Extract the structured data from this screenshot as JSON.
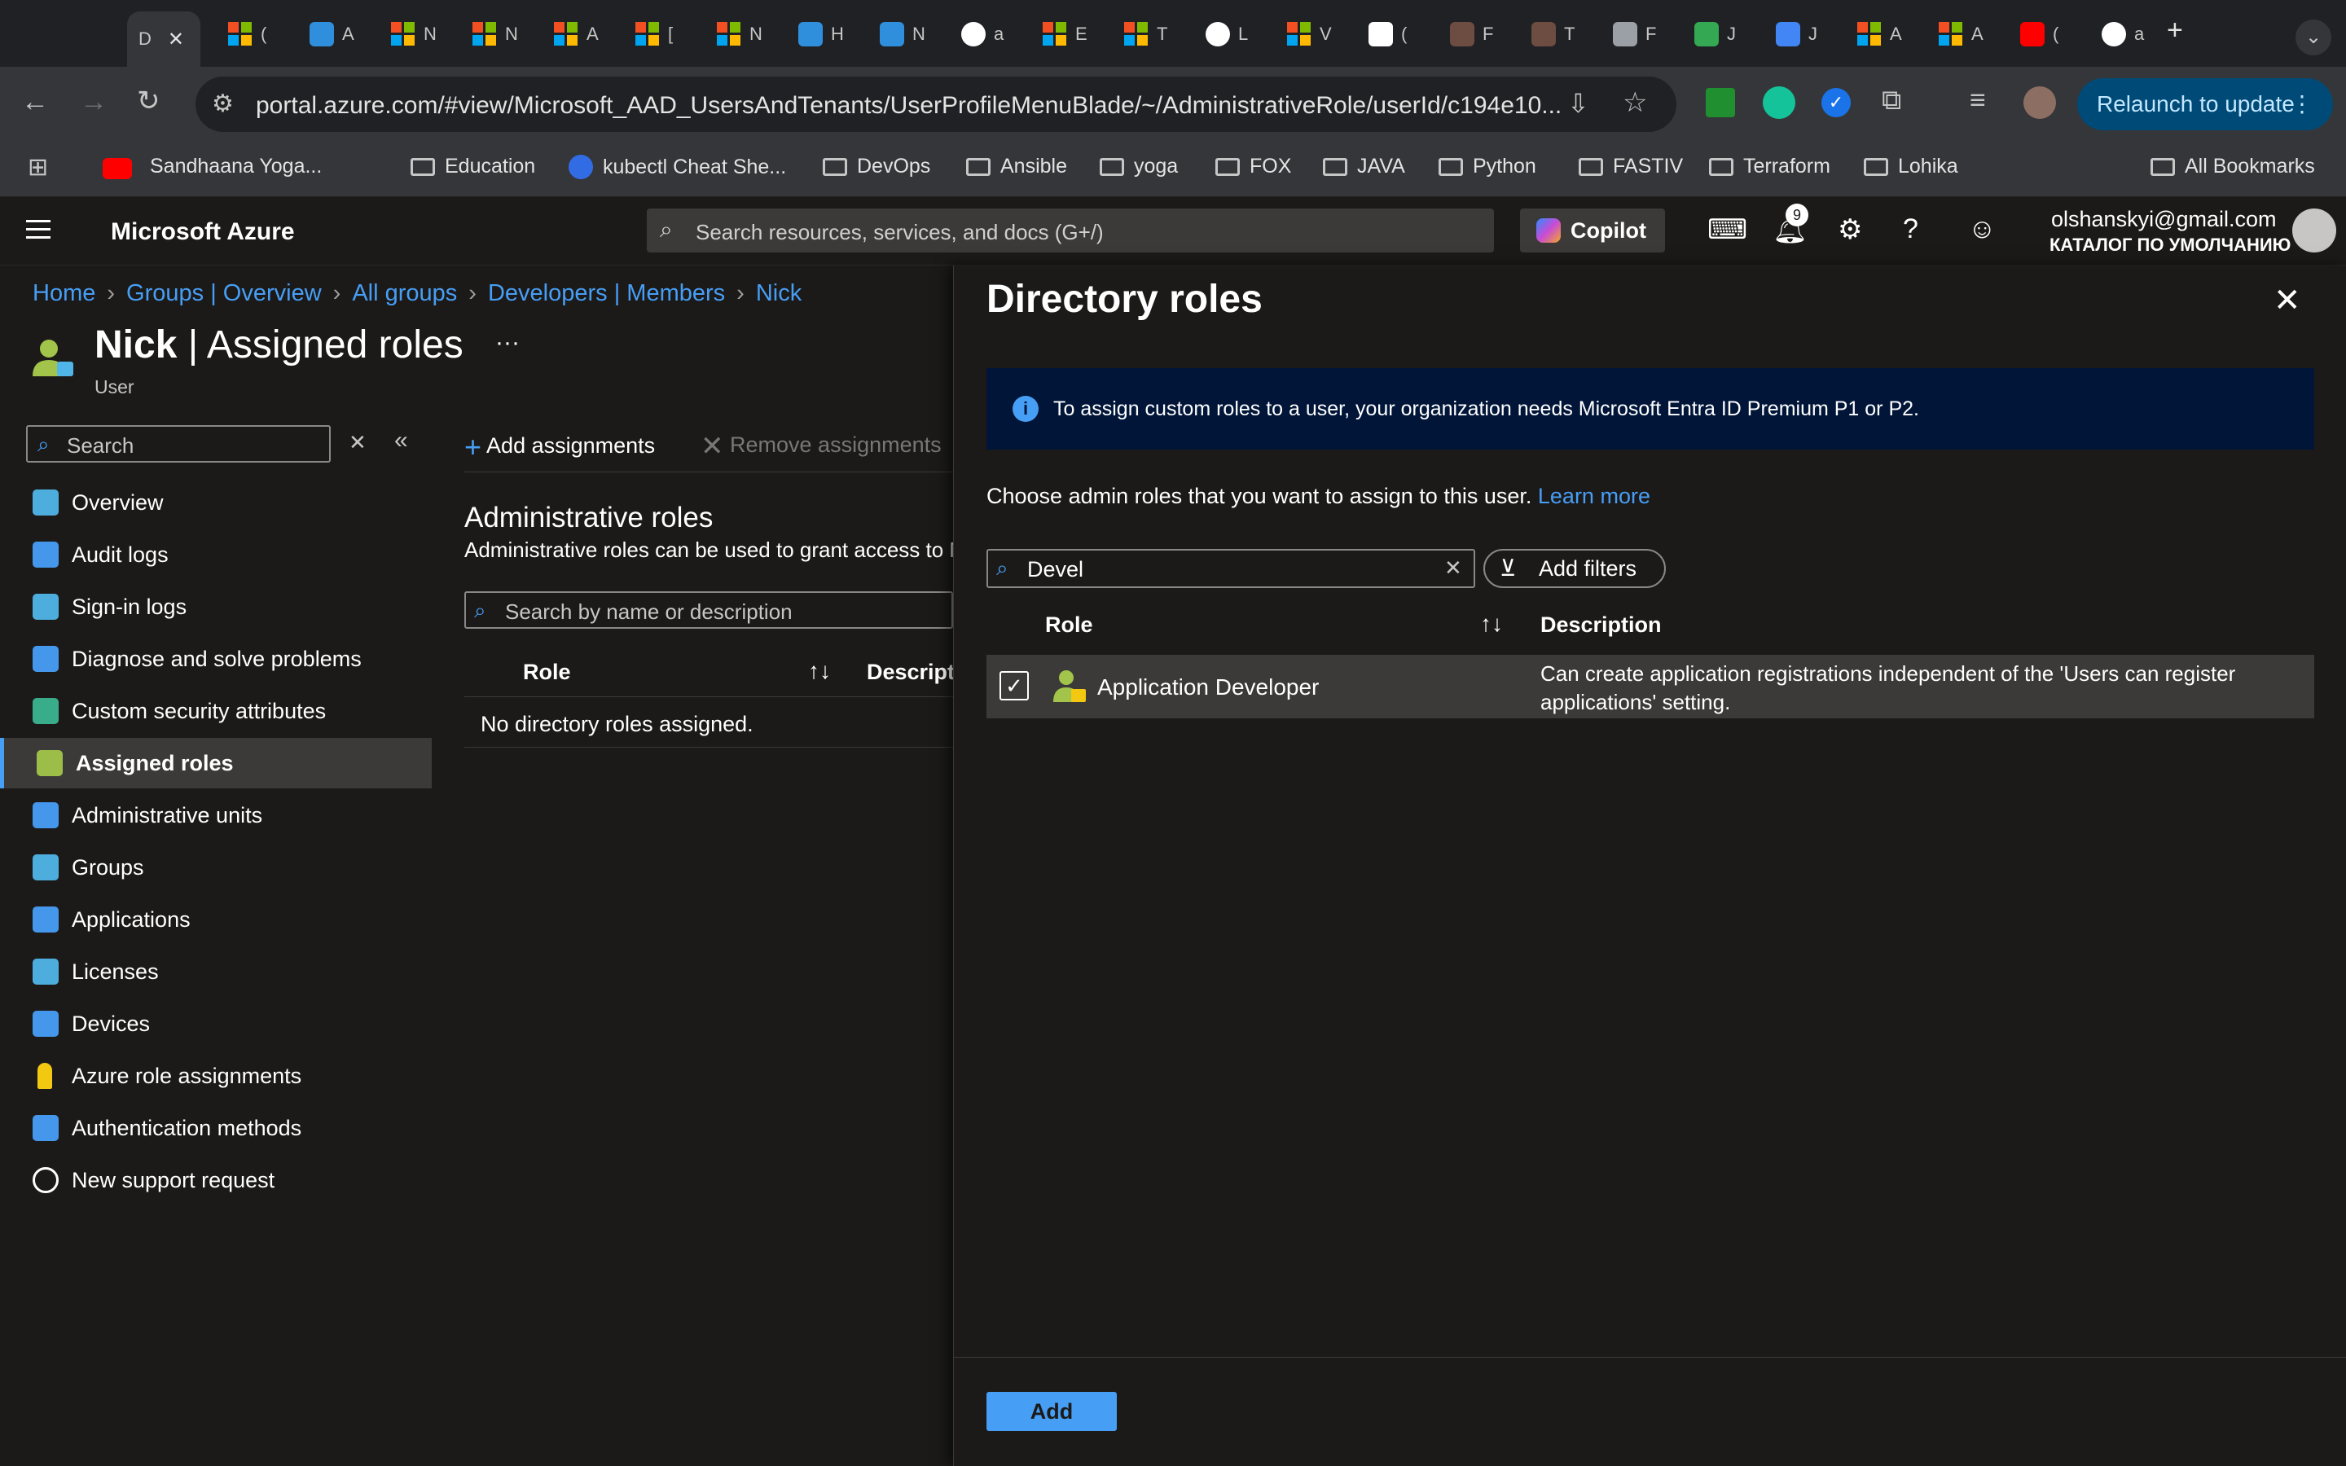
{
  "browser": {
    "url": "portal.azure.com/#view/Microsoft_AAD_UsersAndTenants/UserProfileMenuBlade/~/AdministrativeRole/userId/c194e10...",
    "relaunch_label": "Relaunch to update",
    "tabs": [
      {
        "label": "D",
        "icon": "azure-icon"
      },
      {
        "label": "(",
        "icon": "microsoft-icon"
      },
      {
        "label": "A",
        "icon": "edge-icon"
      },
      {
        "label": "N",
        "icon": "microsoft-icon"
      },
      {
        "label": "N",
        "icon": "microsoft-icon"
      },
      {
        "label": "A",
        "icon": "microsoft-icon"
      },
      {
        "label": "[",
        "icon": "microsoft-icon"
      },
      {
        "label": "N",
        "icon": "microsoft-icon"
      },
      {
        "label": "H",
        "icon": "edge-icon"
      },
      {
        "label": "N",
        "icon": "edge-icon"
      },
      {
        "label": "a",
        "icon": "google-icon"
      },
      {
        "label": "E",
        "icon": "microsoft-icon"
      },
      {
        "label": "T",
        "icon": "microsoft-icon"
      },
      {
        "label": "L",
        "icon": "google-icon"
      },
      {
        "label": "V",
        "icon": "microsoft-icon"
      },
      {
        "label": "(",
        "icon": "gmail-icon"
      },
      {
        "label": "F",
        "icon": "extension-icon"
      },
      {
        "label": "T",
        "icon": "extension-icon"
      },
      {
        "label": "F",
        "icon": "globe-icon"
      },
      {
        "label": "J",
        "icon": "drive-icon"
      },
      {
        "label": "J",
        "icon": "docs-icon"
      },
      {
        "label": "A",
        "icon": "microsoft-icon"
      },
      {
        "label": "A",
        "icon": "microsoft-icon"
      },
      {
        "label": "(",
        "icon": "youtube-icon"
      },
      {
        "label": "a",
        "icon": "google-icon"
      }
    ],
    "bookmarks": [
      {
        "label": "Sandhaana Yoga..."
      },
      {
        "label": "Education"
      },
      {
        "label": "kubectl Cheat She..."
      },
      {
        "label": "DevOps"
      },
      {
        "label": "Ansible"
      },
      {
        "label": "yoga"
      },
      {
        "label": "FOX"
      },
      {
        "label": "JAVA"
      },
      {
        "label": "Python"
      },
      {
        "label": "FASTIV"
      },
      {
        "label": "Terraform"
      },
      {
        "label": "Lohika"
      }
    ],
    "all_bookmarks_label": "All Bookmarks"
  },
  "azure": {
    "brand": "Microsoft Azure",
    "search_placeholder": "Search resources, services, and docs (G+/)",
    "copilot_label": "Copilot",
    "notifications_count": "9",
    "account_email": "olshanskyi@gmail.com",
    "account_directory": "КАТАЛОГ ПО УМОЛЧАНИЮ"
  },
  "breadcrumb": [
    "Home",
    "Groups | Overview",
    "All groups",
    "Developers | Members",
    "Nick"
  ],
  "page": {
    "title_name": "Nick",
    "title_rest": " | Assigned roles",
    "subtitle": "User",
    "more": "···"
  },
  "nav": {
    "search_placeholder": "Search",
    "items": [
      {
        "label": "Overview",
        "icon": "user-icon"
      },
      {
        "label": "Audit logs",
        "icon": "audit-log-icon"
      },
      {
        "label": "Sign-in logs",
        "icon": "sign-in-icon"
      },
      {
        "label": "Diagnose and solve problems",
        "icon": "wrench-icon"
      },
      {
        "label": "Custom security attributes",
        "icon": "attributes-icon"
      },
      {
        "label": "Assigned roles",
        "icon": "assigned-roles-icon"
      },
      {
        "label": "Administrative units",
        "icon": "admin-units-icon"
      },
      {
        "label": "Groups",
        "icon": "groups-icon"
      },
      {
        "label": "Applications",
        "icon": "applications-icon"
      },
      {
        "label": "Licenses",
        "icon": "license-icon"
      },
      {
        "label": "Devices",
        "icon": "devices-icon"
      },
      {
        "label": "Azure role assignments",
        "icon": "key-icon"
      },
      {
        "label": "Authentication methods",
        "icon": "shield-icon"
      },
      {
        "label": "New support request",
        "icon": "support-icon"
      }
    ]
  },
  "middle": {
    "add_assignments": "Add assignments",
    "remove_assignments": "Remove assignments",
    "section_title": "Administrative roles",
    "section_desc": "Administrative roles can be used to grant access to M",
    "search_placeholder": "Search by name or description",
    "col_role": "Role",
    "col_desc": "Descripti",
    "empty": "No directory roles assigned."
  },
  "pane": {
    "title": "Directory roles",
    "info": "To assign custom roles to a user, your organization needs Microsoft Entra ID Premium P1 or P2.",
    "choose_text": "Choose admin roles that you want to assign to this user.",
    "learn_more": "Learn more",
    "search_value": "Devel",
    "add_filters": "Add filters",
    "col_role": "Role",
    "col_desc": "Description",
    "rows": [
      {
        "role": "Application Developer",
        "description": "Can create application registrations independent of the 'Users can register applications' setting.",
        "checked": true
      }
    ],
    "add_button": "Add"
  },
  "colors": {
    "accent": "#479ef5",
    "background": "#1b1a19",
    "info_bar": "#001538",
    "selected_row": "#3b3a39"
  }
}
